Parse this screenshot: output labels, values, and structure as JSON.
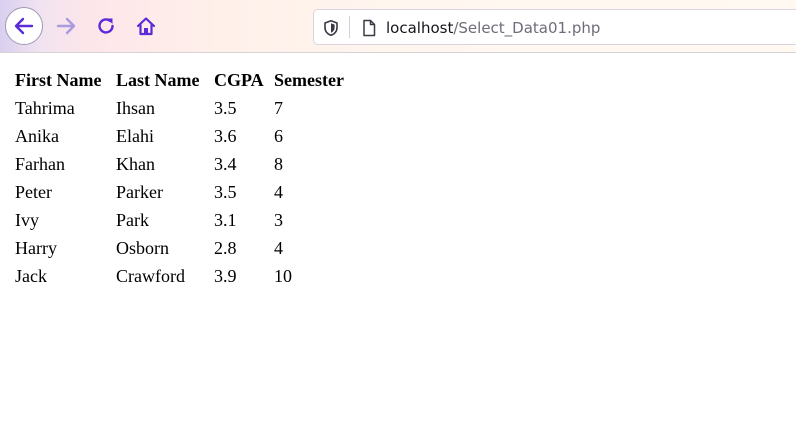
{
  "browser": {
    "icons": {
      "back": "back-arrow-icon",
      "forward": "forward-arrow-icon",
      "reload": "reload-icon",
      "home": "home-icon",
      "tracking": "shield-icon",
      "page": "page-icon"
    },
    "url": {
      "host": "localhost",
      "path": "/Select_Data01.php"
    },
    "colors": {
      "nav_icon": "#5b2bd9",
      "nav_icon_disabled": "#a99be0"
    }
  },
  "table": {
    "headers": [
      "First Name",
      "Last Name",
      "CGPA",
      "Semester"
    ],
    "rows": [
      [
        "Tahrima",
        "Ihsan",
        "3.5",
        "7"
      ],
      [
        "Anika",
        "Elahi",
        "3.6",
        "6"
      ],
      [
        "Farhan",
        "Khan",
        "3.4",
        "8"
      ],
      [
        "Peter",
        "Parker",
        "3.5",
        "4"
      ],
      [
        "Ivy",
        "Park",
        "3.1",
        "3"
      ],
      [
        "Harry",
        "Osborn",
        "2.8",
        "4"
      ],
      [
        "Jack",
        "Crawford",
        "3.9",
        "10"
      ]
    ]
  }
}
